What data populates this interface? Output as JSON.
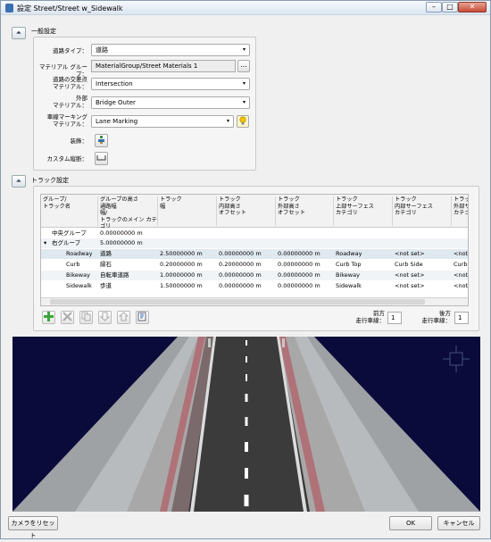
{
  "window": {
    "title": "設定 Street/Street w_Sidewalk"
  },
  "general": {
    "section_title": "一般設定",
    "street_type": {
      "label": "道路タイプ：",
      "value": "道路"
    },
    "material_group": {
      "label": "マテリアル グループ：",
      "value": "MaterialGroup/Street Materials 1",
      "browse_label": "..."
    },
    "intersection_material": {
      "label": "道路の交差点\nマテリアル：",
      "value": "Intersection"
    },
    "outer_material": {
      "label": "外部\nマテリアル：",
      "value": "Bridge Outer"
    },
    "lane_marking_material": {
      "label": "車線マーキング\nマテリアル：",
      "value": "Lane Marking"
    },
    "decoration": {
      "label": "装飾："
    },
    "custom_profile": {
      "label": "カスタム縦断："
    }
  },
  "tracks": {
    "section_title": "トラック設定",
    "columns": [
      "グループ/\nトラック名",
      "グループの高さ\n通路幅\n幅/\nトラックのメイン カテゴリ",
      "トラック\n幅",
      "トラック\n内部高さ\nオフセット",
      "トラック\n外部高さ\nオフセット",
      "トラック\n上部サーフェス\nカテゴリ",
      "トラック\n内部サーフェス\nカテゴリ",
      "トラック\n外部サーフェ\nカテゴリ"
    ],
    "groups": [
      {
        "name": "中央グループ",
        "height": "0.00000000 m"
      },
      {
        "name": "右グループ",
        "height": "5.00000000 m"
      }
    ],
    "rows": [
      {
        "name": "Roadway",
        "category": "道路",
        "width": "2.50000000 m",
        "inner": "0.00000000 m",
        "outer": "0.00000000 m",
        "top": "Roadway",
        "inner_surface": "<not set>",
        "outer_surface": "<not set>"
      },
      {
        "name": "Curb",
        "category": "縁石",
        "width": "0.20000000 m",
        "inner": "0.20000000 m",
        "outer": "0.00000000 m",
        "top": "Curb Top",
        "inner_surface": "Curb Side",
        "outer_surface": "Curb Si"
      },
      {
        "name": "Bikeway",
        "category": "自転車道路",
        "width": "1.00000000 m",
        "inner": "0.00000000 m",
        "outer": "0.00000000 m",
        "top": "Bikeway",
        "inner_surface": "<not set>",
        "outer_surface": "<not se"
      },
      {
        "name": "Sidewalk",
        "category": "歩道",
        "width": "1.50000000 m",
        "inner": "0.00000000 m",
        "outer": "0.00000000 m",
        "top": "Sidewalk",
        "inner_surface": "<not set>",
        "outer_surface": "<not se"
      }
    ],
    "front_lanes_label": "前方\n走行車線：",
    "front_lanes_value": "1",
    "back_lanes_label": "後方\n走行車線：",
    "back_lanes_value": "1"
  },
  "footer": {
    "reset_camera": "カメラをリセット",
    "ok": "OK",
    "cancel": "キャンセル"
  },
  "window_controls": {
    "minimize": "–",
    "maximize": "□",
    "close": "✕"
  },
  "icons": {
    "collapse": "⏶",
    "dropdown": "▾",
    "tree_expand": "▾"
  }
}
